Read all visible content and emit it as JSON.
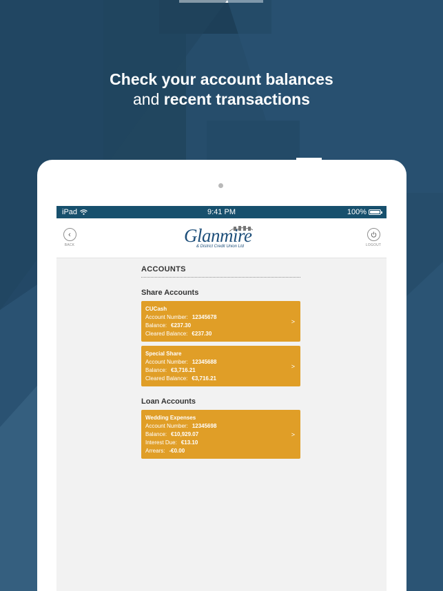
{
  "headline": {
    "line1": "Check your account balances",
    "line2_light": "and",
    "line2_bold": "recent transactions"
  },
  "statusbar": {
    "carrier": "iPad",
    "time": "9:41 PM",
    "battery": "100%"
  },
  "appbar": {
    "back_label": "BACK",
    "logout_label": "LOGOUT",
    "logo_name": "Glanmire",
    "logo_tagline": "& District Credit Union Ltd"
  },
  "accounts": {
    "title": "ACCOUNTS",
    "share_title": "Share Accounts",
    "share": [
      {
        "name": "CUCash",
        "rows": [
          {
            "label": "Account Number:",
            "value": "12345678"
          },
          {
            "label": "Balance:",
            "value": "€237.30"
          },
          {
            "label": "Cleared Balance:",
            "value": "€237.30"
          }
        ]
      },
      {
        "name": "Special Share",
        "rows": [
          {
            "label": "Account Number:",
            "value": "12345688"
          },
          {
            "label": "Balance:",
            "value": "€3,716.21"
          },
          {
            "label": "Cleared Balance:",
            "value": "€3,716.21"
          }
        ]
      }
    ],
    "loan_title": "Loan Accounts",
    "loan": [
      {
        "name": "Wedding Expenses",
        "rows": [
          {
            "label": "Account Number:",
            "value": "12345698"
          },
          {
            "label": "Balance:",
            "value": "€10,929.07"
          },
          {
            "label": "Interest Due:",
            "value": "€13.10"
          },
          {
            "label": "Arrears:",
            "value": "-€0.00"
          }
        ]
      }
    ],
    "arrow_glyph": ">"
  },
  "colors": {
    "background": "#27506f",
    "statusbar": "#17506d",
    "card": "#e09e27",
    "logo": "#1e4f7a"
  },
  "icons": [
    "wifi-icon",
    "battery-icon",
    "back-chevron-icon",
    "power-icon",
    "chevron-right-icon"
  ]
}
